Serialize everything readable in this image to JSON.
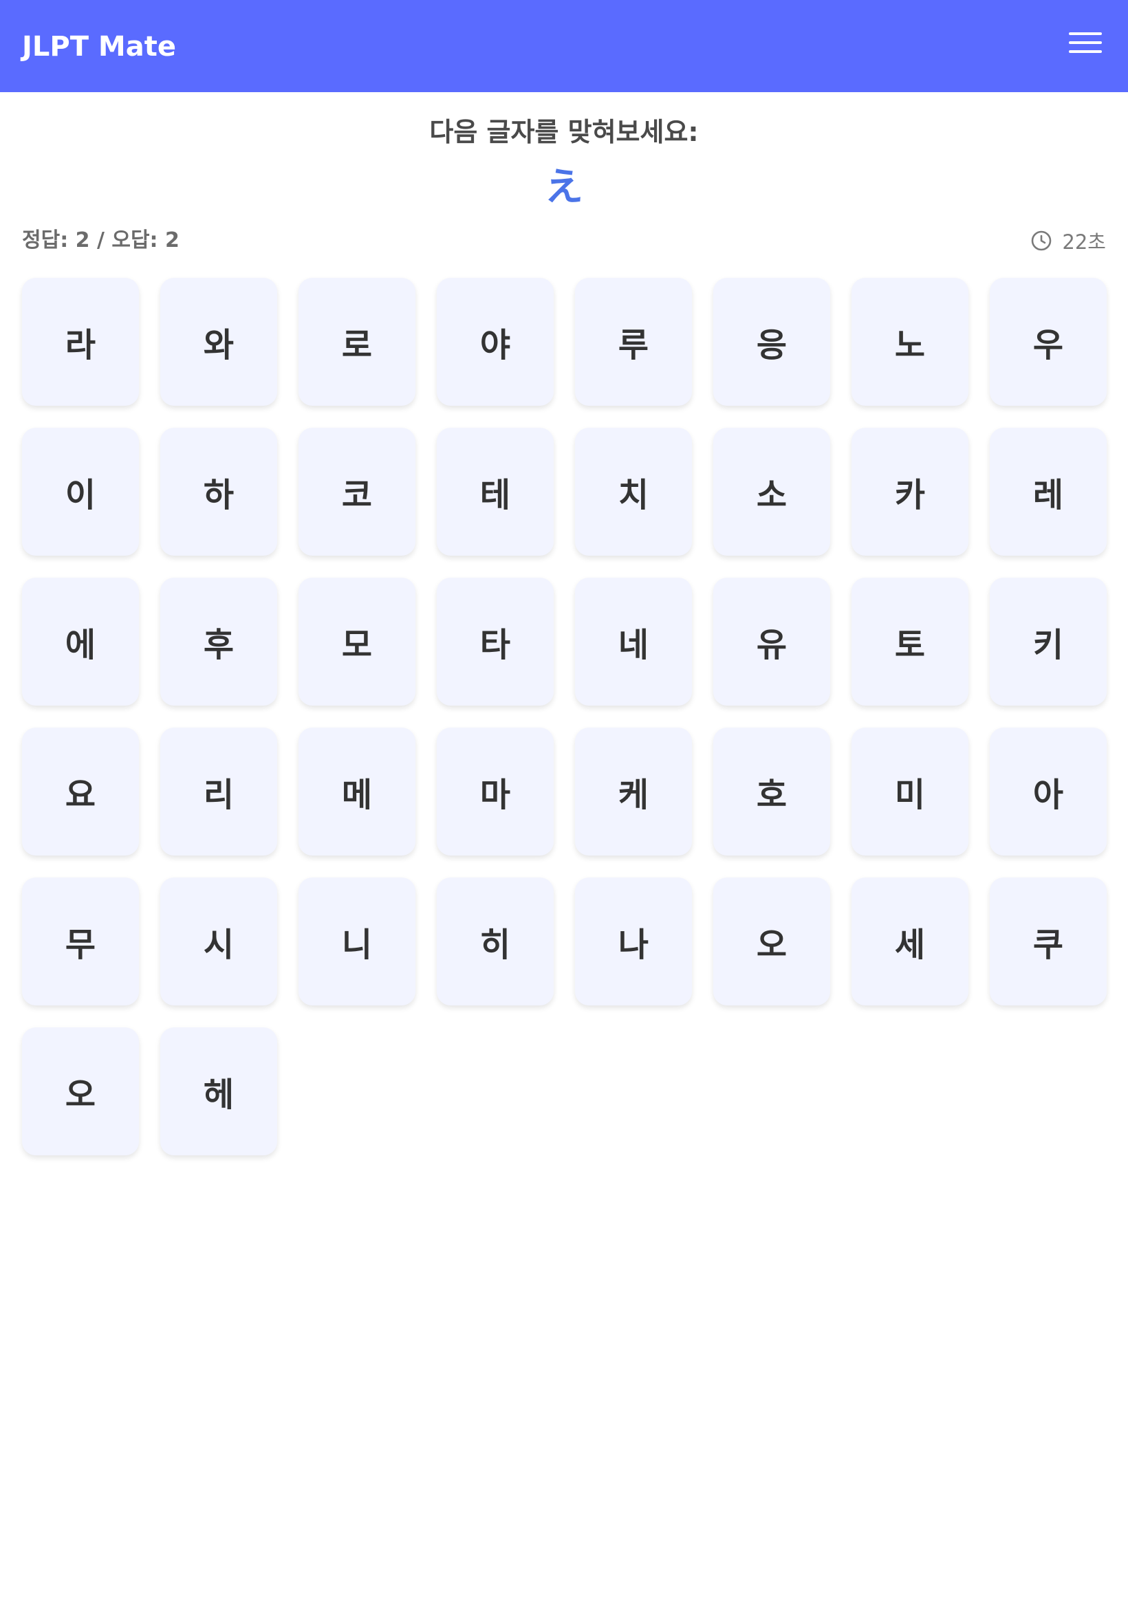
{
  "header": {
    "title": "JLPT Mate",
    "menu_icon": "hamburger-menu-icon"
  },
  "quiz": {
    "prompt": "다음 글자를 맞혀보세요:",
    "question": "え",
    "score_text": "정답: 2 / 오답: 2",
    "timer_text": "22초",
    "timer_icon": "clock-icon",
    "question_color": "#4b74e8"
  },
  "colors": {
    "header_bg": "#5a6bff",
    "tile_bg": "#f2f4ff"
  },
  "options": [
    "라",
    "와",
    "로",
    "야",
    "루",
    "응",
    "노",
    "우",
    "이",
    "하",
    "코",
    "테",
    "치",
    "소",
    "카",
    "레",
    "에",
    "후",
    "모",
    "타",
    "네",
    "유",
    "토",
    "키",
    "요",
    "리",
    "메",
    "마",
    "케",
    "호",
    "미",
    "아",
    "무",
    "시",
    "니",
    "히",
    "나",
    "오",
    "세",
    "쿠",
    "오",
    "헤"
  ]
}
